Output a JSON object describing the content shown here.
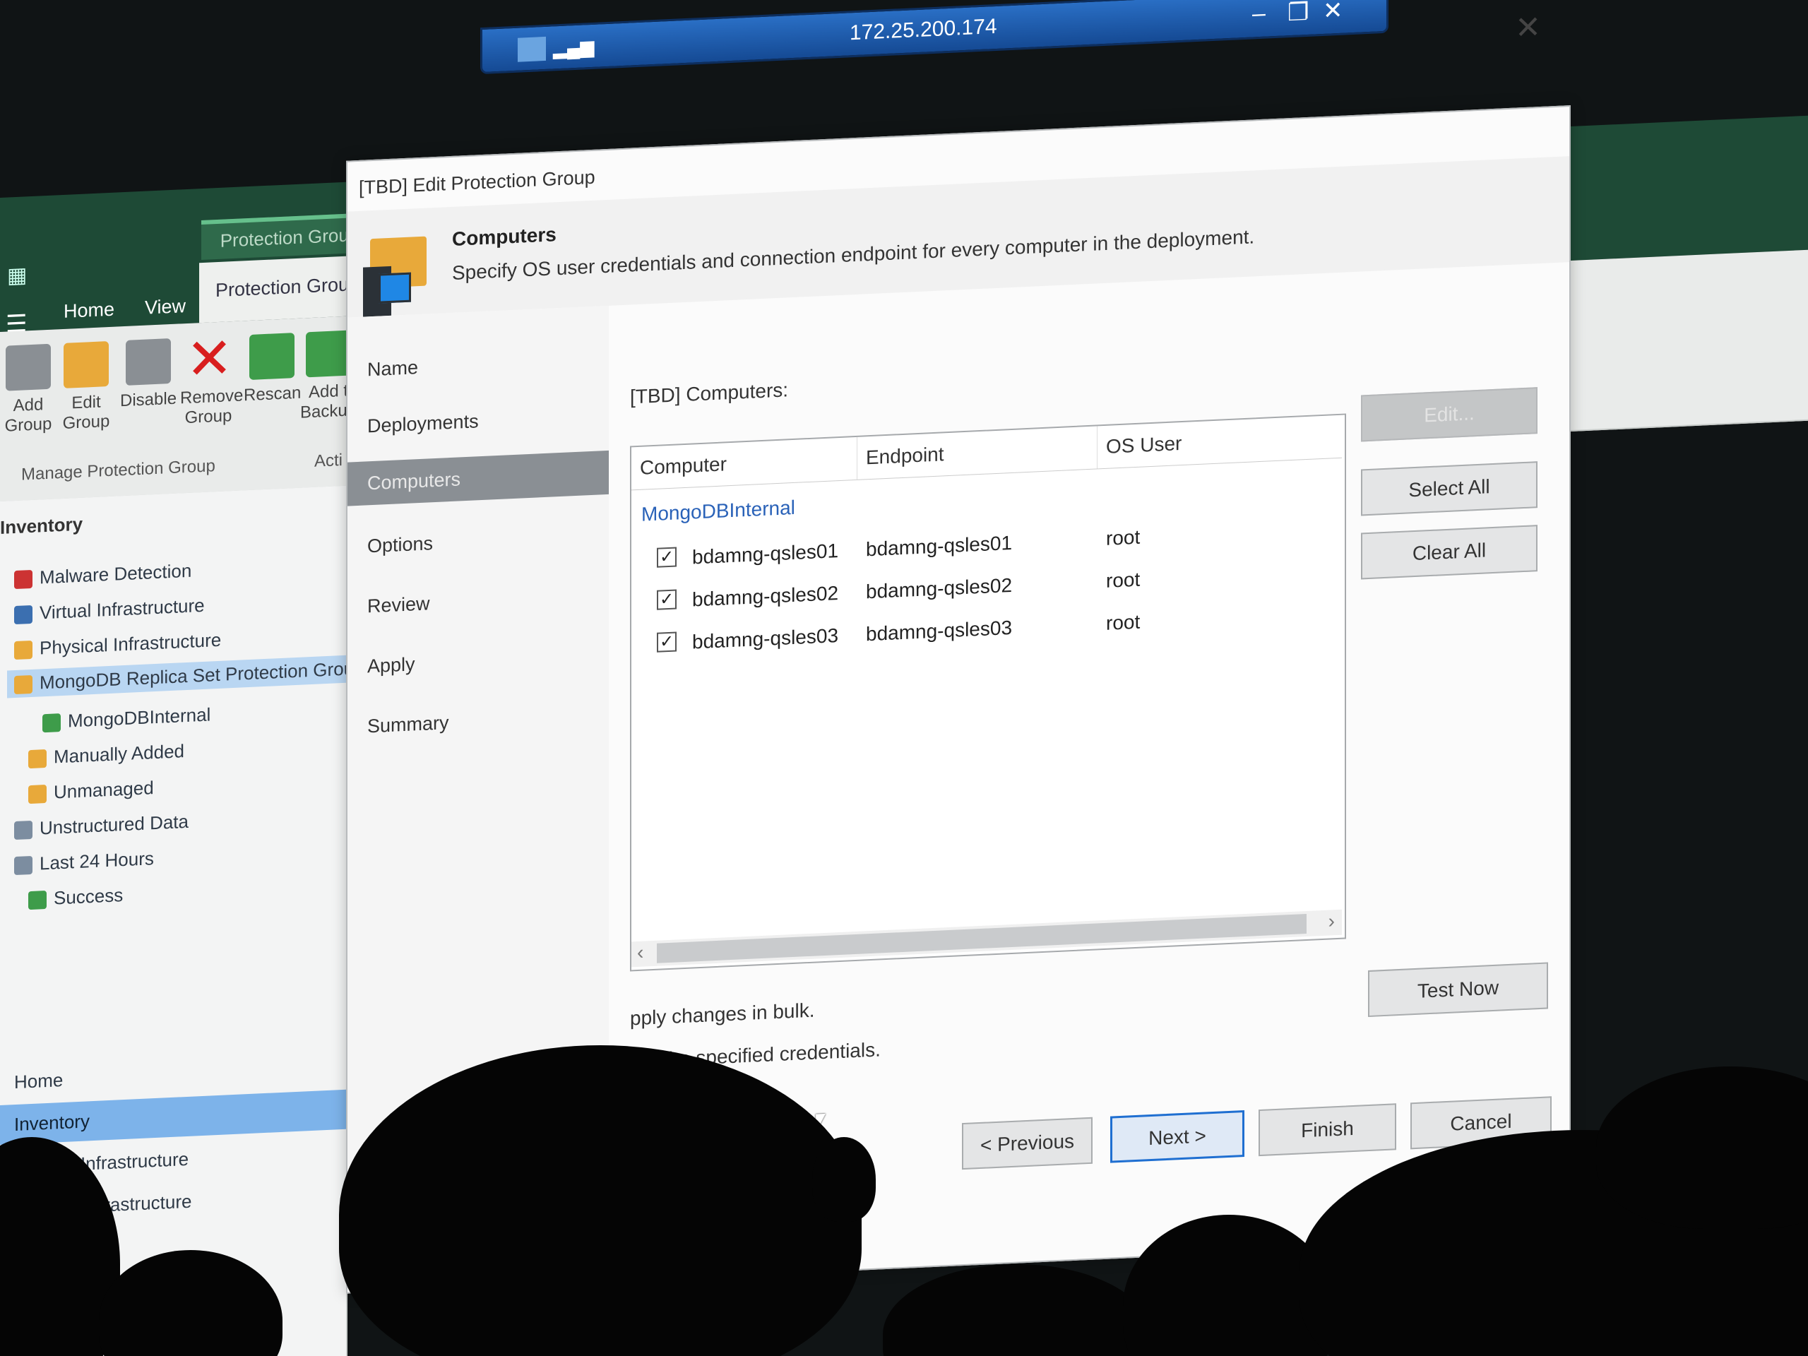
{
  "remote_session": {
    "host_ip": "172.25.200.174"
  },
  "console": {
    "menu_icon": "hamburger-menu-icon",
    "context_tab": "Protection Group Tools",
    "tabs": [
      {
        "label": "Home"
      },
      {
        "label": "View"
      },
      {
        "label": "Protection Group"
      }
    ],
    "ribbon": {
      "buttons": [
        {
          "line1": "Add",
          "line2": "Group",
          "icon": "add-group-icon"
        },
        {
          "line1": "Edit",
          "line2": "Group",
          "icon": "edit-group-icon"
        },
        {
          "line1": "Disable",
          "line2": "",
          "icon": "disable-icon"
        },
        {
          "line1": "Remove",
          "line2": "Group",
          "icon": "remove-icon"
        },
        {
          "line1": "Rescan",
          "line2": "",
          "icon": "rescan-icon"
        },
        {
          "line1": "Add t",
          "line2": "Backup",
          "icon": "add-to-backup-icon"
        }
      ],
      "group_label": "Manage Protection Group",
      "group_label_2": "Acti"
    },
    "inventory": {
      "title": "Inventory",
      "tree": [
        {
          "label": "Malware Detection"
        },
        {
          "label": "Virtual Infrastructure"
        },
        {
          "label": "Physical Infrastructure"
        },
        {
          "label": "MongoDB Replica Set Protection Group"
        },
        {
          "label": "MongoDBInternal"
        },
        {
          "label": "Manually Added"
        },
        {
          "label": "Unmanaged"
        },
        {
          "label": "Unstructured Data"
        },
        {
          "label": "Last 24 Hours"
        },
        {
          "label": "Success"
        }
      ]
    },
    "nav": [
      {
        "label": "Home"
      },
      {
        "label": "Inventory"
      },
      {
        "label": "Backup Infrastructure"
      },
      {
        "label": "Storage Infrastructure"
      },
      {
        "label": "nfrastructure"
      }
    ]
  },
  "dialog": {
    "title": "[TBD] Edit Protection Group",
    "header": {
      "title": "Computers",
      "subtitle": "Specify OS user credentials and connection endpoint for every computer in the deployment."
    },
    "steps": [
      {
        "label": "Name"
      },
      {
        "label": "Deployments"
      },
      {
        "label": "Computers"
      },
      {
        "label": "Options"
      },
      {
        "label": "Review"
      },
      {
        "label": "Apply"
      },
      {
        "label": "Summary"
      }
    ],
    "grid": {
      "caption": "[TBD] Computers:",
      "columns": [
        "Computer",
        "Endpoint",
        "OS User"
      ],
      "group": "MongoDBInternal",
      "rows": [
        {
          "checked": "✓",
          "computer": "bdamng-qsles01",
          "endpoint": "bdamng-qsles01",
          "os_user": "root"
        },
        {
          "checked": "✓",
          "computer": "bdamng-qsles02",
          "endpoint": "bdamng-qsles02",
          "os_user": "root"
        },
        {
          "checked": "✓",
          "computer": "bdamng-qsles03",
          "endpoint": "bdamng-qsles03",
          "os_user": "root"
        }
      ]
    },
    "side_buttons": {
      "edit": "Edit...",
      "select_all": "Select All",
      "clear_all": "Clear All"
    },
    "hints": {
      "line1": "pply changes in bulk.",
      "line2": "ate the specified credentials."
    },
    "test_now": "Test Now",
    "footer": {
      "previous": "< Previous",
      "next": "Next >",
      "finish": "Finish",
      "cancel": "Cancel"
    }
  }
}
